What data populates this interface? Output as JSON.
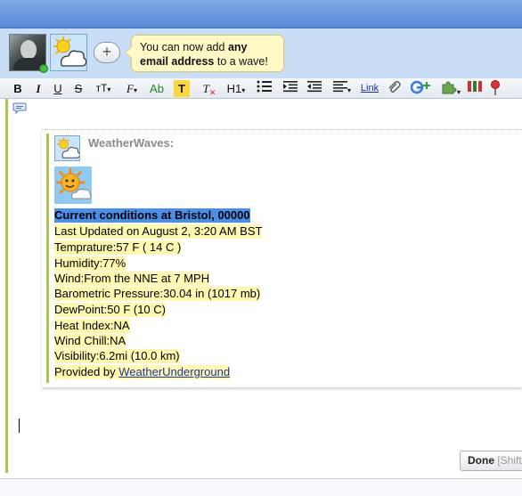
{
  "participants": {
    "tooltip": {
      "before": "You can now add ",
      "bold1": "any",
      "bold2": "email address",
      "after": " to a wave!"
    },
    "add_label": "+"
  },
  "toolbar": {
    "bold": "B",
    "italic": "I",
    "underline": "U",
    "strike": "S",
    "size": "тT",
    "font": "F",
    "color": "Ab",
    "highlight": "T",
    "clear": "T",
    "heading": "H1",
    "link": "Link"
  },
  "blip": {
    "author": "WeatherWaves:",
    "lines": [
      "Current conditions at Bristol, 00000",
      "Last Updated on August 2, 3:20 AM BST",
      "Temprature:57 F ( 14 C )",
      "Humidity:77%",
      "Wind:From the NNE at 7 MPH",
      "Barometric Pressure:30.04 in (1017 mb)",
      "DewPoint:50 F (10 C)",
      "Heat Index:NA",
      "Wind Chill:NA",
      "Visibility:6.2mi (10.0 km)"
    ],
    "provided_prefix": "Provided by ",
    "provided_link": "WeatherUnderground"
  },
  "footer": {
    "done_label": "Done",
    "done_hint": "[Shift+Enter]"
  },
  "colors": {
    "selection": "#4a8fe7",
    "highlight": "#fff9b0",
    "thread_bar": "#aac44e",
    "topbar": "#6b96e0"
  },
  "icons": [
    "bullet-list-icon",
    "indent-icon",
    "outdent-icon",
    "align-icon",
    "attachment-icon",
    "google-plus-icon",
    "puzzle-icon",
    "chart-icon",
    "map-pin-icon",
    "reply-icon",
    "sun-cloud-icon"
  ]
}
